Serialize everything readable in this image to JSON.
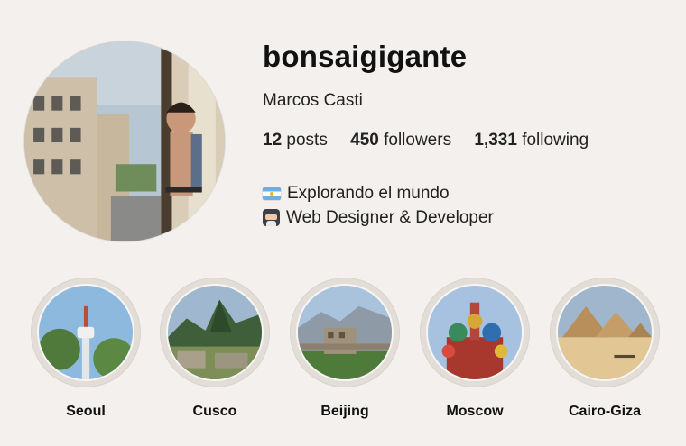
{
  "profile": {
    "username": "bonsaigigante",
    "full_name": "Marcos Casti",
    "stats": {
      "posts_count": "12",
      "posts_label": "posts",
      "followers_count": "450",
      "followers_label": "followers",
      "following_count": "1,331",
      "following_label": "following"
    },
    "bio": [
      {
        "icon": "argentina-flag-icon",
        "text": "Explorando el mundo"
      },
      {
        "icon": "ninja-icon",
        "text": "Web Designer & Developer"
      }
    ]
  },
  "highlights": [
    {
      "label": "Seoul"
    },
    {
      "label": "Cusco"
    },
    {
      "label": "Beijing"
    },
    {
      "label": "Moscow"
    },
    {
      "label": "Cairo-Giza"
    }
  ]
}
